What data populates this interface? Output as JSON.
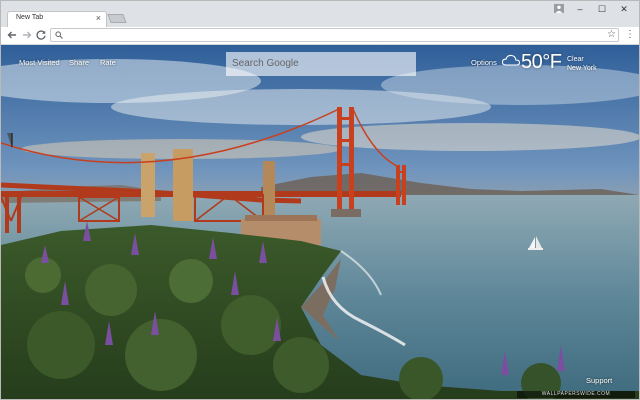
{
  "browser": {
    "tab_title": "New Tab",
    "tab_close": "×",
    "window_controls": {
      "minimize": "–",
      "maximize": "☐",
      "close": "✕"
    },
    "star": "☆",
    "menu": "⋮"
  },
  "newtab": {
    "links": [
      "Most Visited",
      "Share",
      "Rate"
    ],
    "search_placeholder": "Search Google",
    "options_label": "Options",
    "weather": {
      "temperature": "50°F",
      "condition": "Clear",
      "location": "New York",
      "icon": "cloud-icon"
    },
    "support_label": "Support",
    "watermark": "WALLPAPERSWIDE.COM"
  },
  "colors": {
    "sky_top": "#3d6ea8",
    "horizon": "#f0b46a",
    "bridge": "#c9401e",
    "water": "#5f8aa0",
    "foliage": "#3e5f2c",
    "flowers": "#7a4fa0"
  }
}
